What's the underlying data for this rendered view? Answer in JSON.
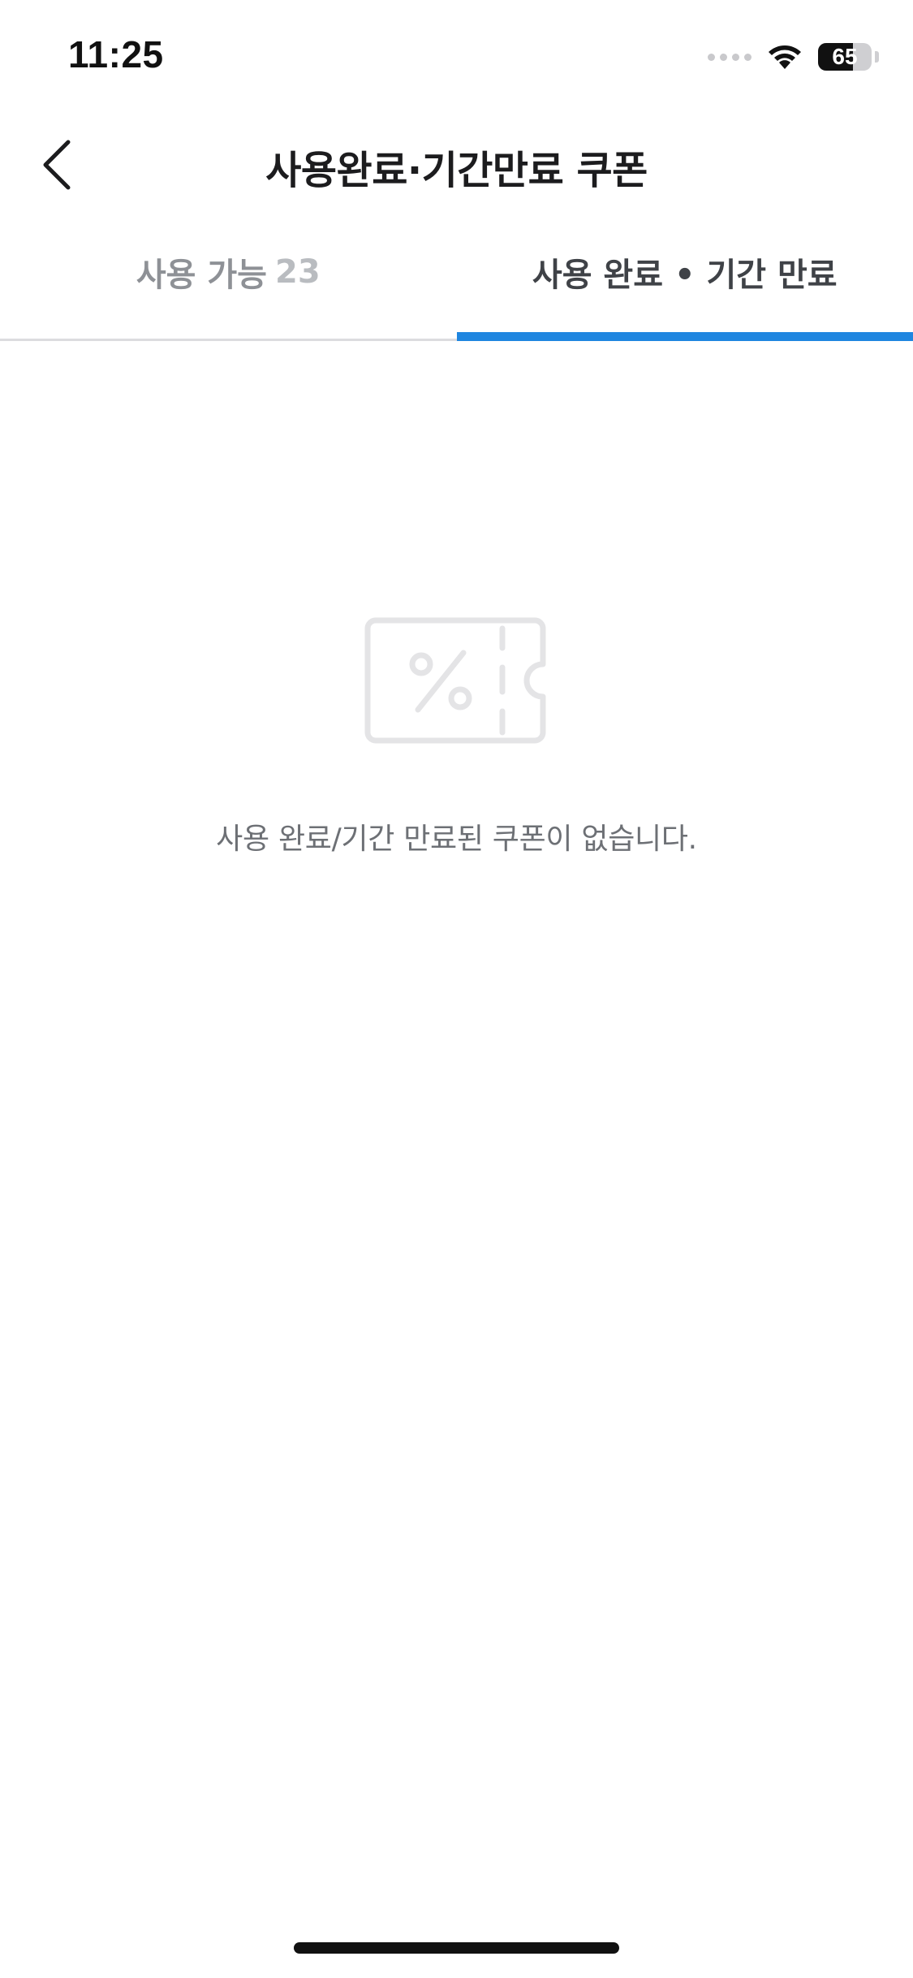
{
  "status_bar": {
    "time": "11:25",
    "battery_level": 65,
    "battery_label": "65",
    "icons": [
      "cellular-signal-icon",
      "wifi-icon",
      "battery-icon"
    ]
  },
  "nav": {
    "back_icon": "chevron-left-icon",
    "title": "사용완료·기간만료 쿠폰"
  },
  "tabs": [
    {
      "label": "사용 가능",
      "count": "23",
      "active": false
    },
    {
      "label": "사용 완료 • 기간 만료",
      "count": "",
      "active": true
    }
  ],
  "empty_state": {
    "icon": "coupon-percent-icon",
    "message": "사용 완료/기간 만료된 쿠폰이 없습니다."
  },
  "colors": {
    "accent": "#1f86e0",
    "tab_active_text": "#3f4247",
    "tab_inactive_text": "#8e9196",
    "icon_gray": "#e4e4e6",
    "message_text": "#6d7075"
  }
}
